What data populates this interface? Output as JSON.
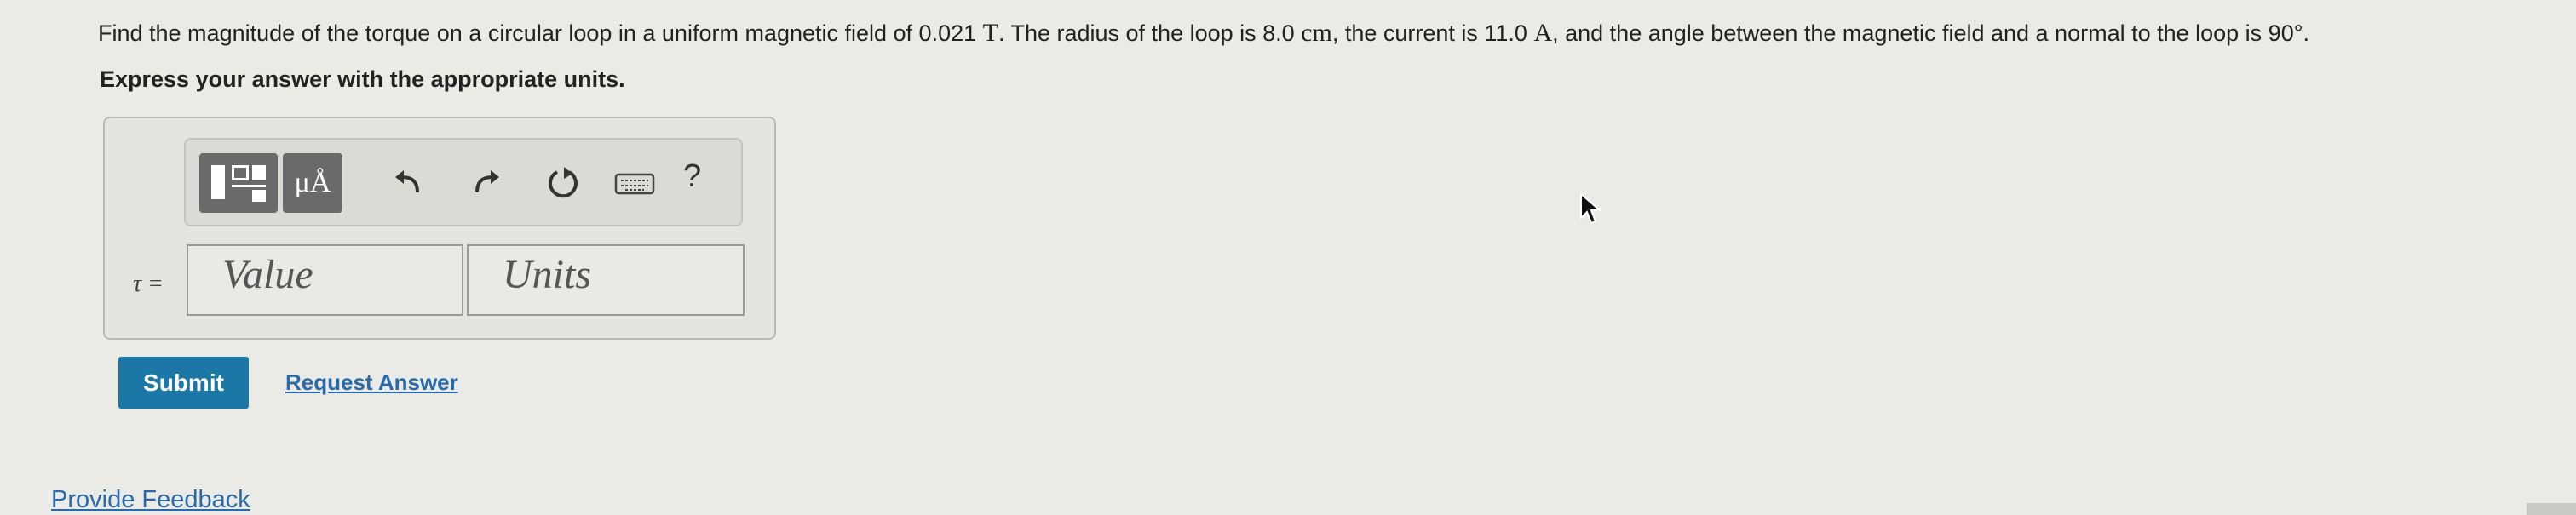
{
  "question": {
    "part1": "Find the magnitude of the torque on a circular loop in a uniform magnetic field of 0.021 ",
    "field_unit": "T",
    "part2": ". The radius of the loop is 8.0 ",
    "radius_unit": "cm",
    "part3": ", the current is 11.0 ",
    "current_unit": "A",
    "part4": ", and the angle between the magnetic field and a normal to the loop is 90°."
  },
  "instruction": "Express your answer with the appropriate units.",
  "toolbar": {
    "units_label": "μÅ",
    "help_label": "?",
    "icons": [
      "templates-icon",
      "units-icon",
      "undo-icon",
      "redo-icon",
      "reset-icon",
      "keyboard-icon",
      "help-icon"
    ]
  },
  "answer": {
    "label": "τ =",
    "value_placeholder": "Value",
    "units_placeholder": "Units"
  },
  "actions": {
    "submit_label": "Submit",
    "request_label": "Request Answer"
  },
  "footer": {
    "feedback_label": "Provide Feedback"
  },
  "colors": {
    "background": "#eaeae7",
    "accent": "#1a77a6",
    "link": "#2a6aa8"
  }
}
